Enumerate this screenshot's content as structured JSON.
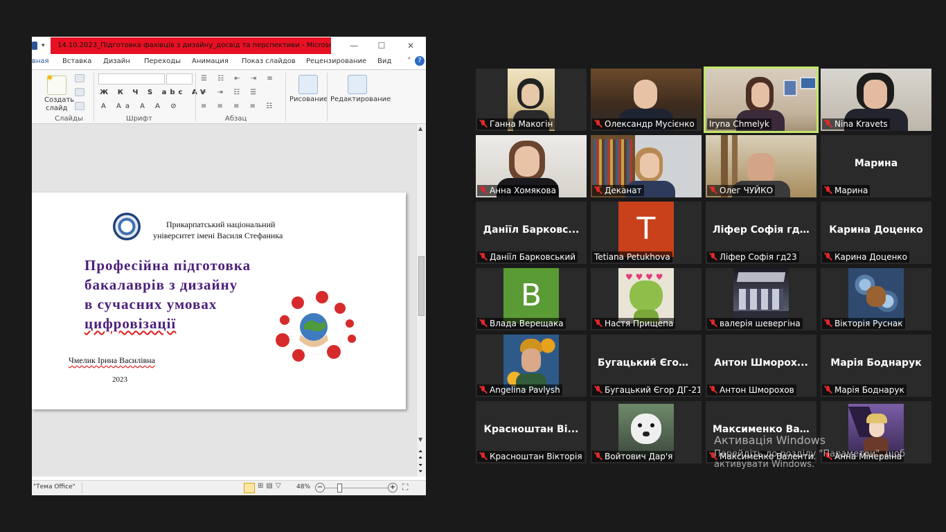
{
  "ppt": {
    "doc_title": "14.10.2023_Підготовка фахівців з дизайну_досвід та перспективи - Microsoft...",
    "tabs": [
      "вная",
      "Вставка",
      "Дизайн",
      "Переходы",
      "Анимация",
      "Показ слайдов",
      "Рецензирование",
      "Вид"
    ],
    "ribbon": {
      "create_slide": "Создать",
      "create_slide2": "слайд",
      "group_slides": "Слайды",
      "group_font": "Шрифт",
      "group_paragraph": "Абзац",
      "drawing": "Рисование",
      "editing": "Редактирование"
    },
    "status": {
      "theme": "\"Тема Office\"",
      "zoom": "48%"
    },
    "slide": {
      "uni_line1": "Прикарпатський національний",
      "uni_line2": "університет імені Василя Стефаника",
      "title_line1": "Професійна підготовка",
      "title_line2": "бакалаврів з дизайну",
      "title_line3": "в сучасних умовах",
      "title_line4": "цифровізації",
      "author": "Чмелик Ірина Василівна",
      "year": "2023"
    }
  },
  "zoom": {
    "participants": [
      {
        "name": "Ганна Макогін",
        "kind": "video"
      },
      {
        "name": "Олександр Мусієнко",
        "kind": "video"
      },
      {
        "name": "Iryna Chmelyk",
        "kind": "video",
        "active": true
      },
      {
        "name": "Nina Kravets",
        "kind": "video"
      },
      {
        "name": "Анна Хомякова",
        "kind": "video"
      },
      {
        "name": "Деканат",
        "kind": "video"
      },
      {
        "name": "Олег ЧУЙКО",
        "kind": "video"
      },
      {
        "name": "Марина",
        "kind": "text",
        "big": "Марина"
      },
      {
        "name": "Даніїл Барковський",
        "kind": "text",
        "big": "Даніїл Барковс..."
      },
      {
        "name": "Tetiana Petukhova",
        "kind": "letter",
        "letter": "T",
        "color": "#c8411b"
      },
      {
        "name": "Ліфер Софія гд23",
        "kind": "text",
        "big": "Ліфер Софія гд23"
      },
      {
        "name": "Карина Доценко",
        "kind": "text",
        "big": "Карина Доценко"
      },
      {
        "name": "Влада Верещака",
        "kind": "letter",
        "letter": "B",
        "color": "#5a9b35"
      },
      {
        "name": "Настя Прищепа",
        "kind": "pic"
      },
      {
        "name": "валерія шевергіна",
        "kind": "pic"
      },
      {
        "name": "Вікторія Руснак",
        "kind": "pic"
      },
      {
        "name": "Angelina Pavlysh",
        "kind": "pic"
      },
      {
        "name": "Бугацький Єгор ДГ-21",
        "kind": "text",
        "big": "Бугацький Єгор..."
      },
      {
        "name": "Антон Шморохов",
        "kind": "text",
        "big": "Антон Шморох..."
      },
      {
        "name": "Марія Боднарук",
        "kind": "text",
        "big": "Марія Боднарук"
      },
      {
        "name": "Красноштан Вікторія",
        "kind": "text",
        "big": "Красноштан Ві..."
      },
      {
        "name": "Войтович Дар'я",
        "kind": "pic"
      },
      {
        "name": "Максименко Валенти...",
        "kind": "text",
        "big": "Максименко Ва..."
      },
      {
        "name": "Анна Мінервіна",
        "kind": "pic"
      }
    ]
  },
  "watermark": {
    "line1": "Активація Windows",
    "line2": "Перейдіть до розділу \"Параметри\", щоб активувати Windows."
  }
}
